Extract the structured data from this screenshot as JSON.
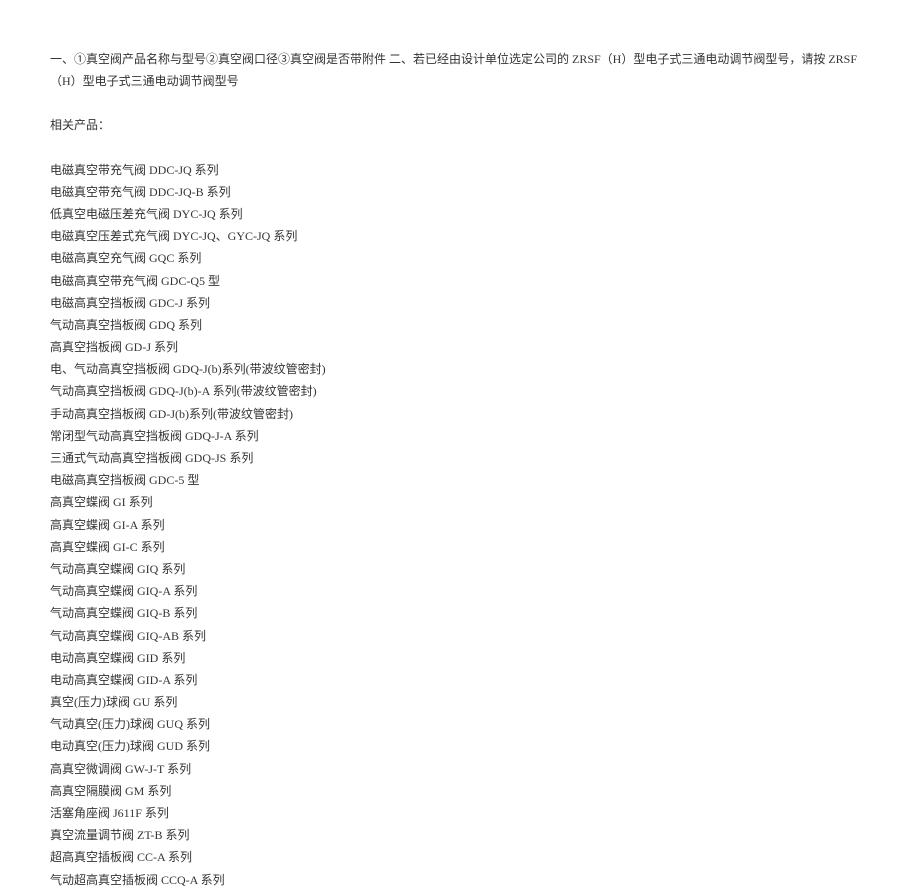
{
  "intro": "一、①真空阀产品名称与型号②真空阀口径③真空阀是否带附件  二、若已经由设计单位选定公司的 ZRSF（H）型电子式三通电动调节阀型号，请按 ZRSF（H）型电子式三通电动调节阀型号",
  "relatedHeading": "相关产品：",
  "products": [
    "电磁真空带充气阀 DDC-JQ 系列",
    "电磁真空带充气阀 DDC-JQ-B 系列",
    "低真空电磁压差充气阀 DYC-JQ 系列",
    "电磁真空压差式充气阀 DYC-JQ、GYC-JQ 系列",
    "电磁高真空充气阀 GQC 系列",
    "电磁高真空带充气阀 GDC-Q5 型",
    "电磁高真空挡板阀 GDC-J 系列",
    "气动高真空挡板阀 GDQ 系列",
    "高真空挡板阀 GD-J 系列",
    "电、气动高真空挡板阀 GDQ-J(b)系列(带波纹管密封)",
    "气动高真空挡板阀 GDQ-J(b)-A 系列(带波纹管密封)",
    "手动高真空挡板阀 GD-J(b)系列(带波纹管密封)",
    "常闭型气动高真空挡板阀 GDQ-J-A 系列",
    "三通式气动高真空挡板阀 GDQ-JS 系列",
    "电磁高真空挡板阀 GDC-5 型",
    "高真空蝶阀 GI 系列",
    "高真空蝶阀 GI-A 系列",
    "高真空蝶阀 GI-C 系列",
    "气动高真空蝶阀 GIQ 系列",
    "气动高真空蝶阀 GIQ-A 系列",
    "气动高真空蝶阀 GIQ-B 系列",
    "气动高真空蝶阀 GIQ-AB 系列",
    "电动高真空蝶阀 GID 系列",
    "电动高真空蝶阀 GID-A 系列",
    "真空(压力)球阀 GU 系列",
    "气动真空(压力)球阀 GUQ 系列",
    "电动真空(压力)球阀 GUD 系列",
    "高真空微调阀 GW-J-T 系列",
    "高真空隔膜阀 GM 系列",
    "活塞角座阀 J611F 系列",
    "真空流量调节阀 ZT-B 系列",
    "超高真空插板阀 CC-A 系列",
    "气动超高真空插板阀 CCQ-A 系列"
  ]
}
